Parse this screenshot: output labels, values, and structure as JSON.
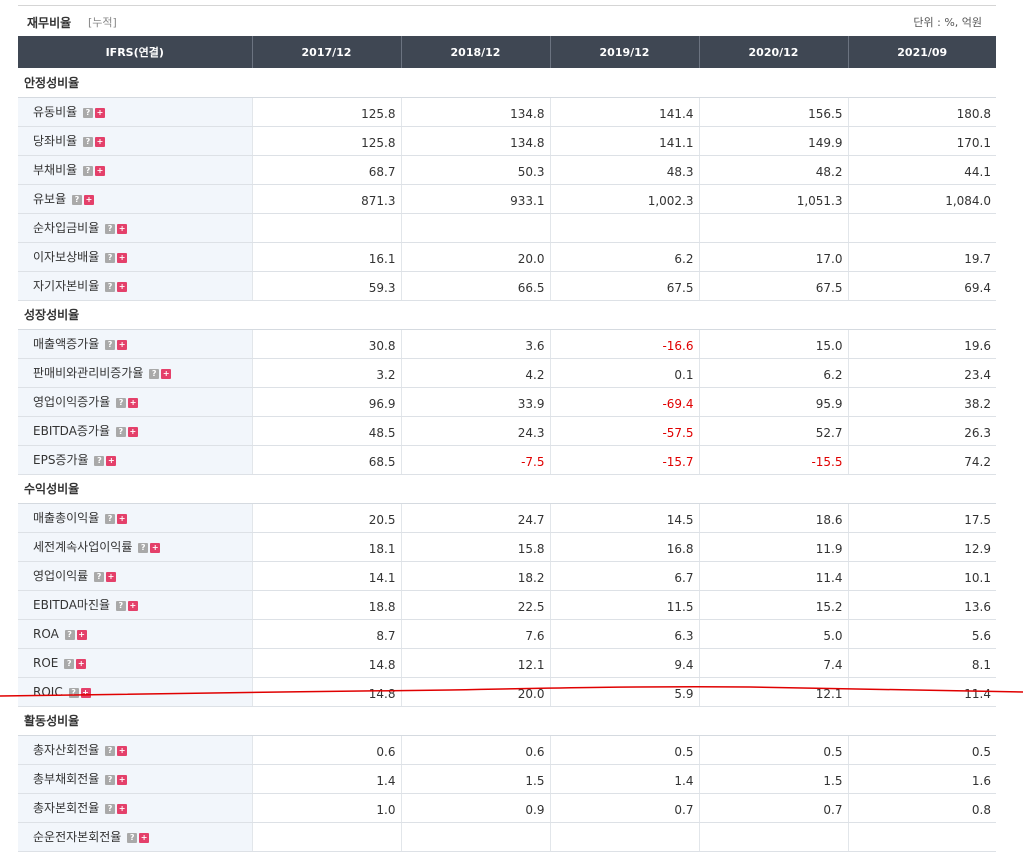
{
  "title": "재무비율",
  "subtitle": "[누적]",
  "unit": "단위 : %, 억원",
  "columns": [
    "IFRS(연결)",
    "2017/12",
    "2018/12",
    "2019/12",
    "2020/12",
    "2021/09"
  ],
  "rows": [
    {
      "section": "안정성비율"
    },
    {
      "label": "유동비율",
      "values": [
        "125.8",
        "134.8",
        "141.4",
        "156.5",
        "180.8"
      ]
    },
    {
      "label": "당좌비율",
      "values": [
        "125.8",
        "134.8",
        "141.1",
        "149.9",
        "170.1"
      ]
    },
    {
      "label": "부채비율",
      "values": [
        "68.7",
        "50.3",
        "48.3",
        "48.2",
        "44.1"
      ]
    },
    {
      "label": "유보율",
      "values": [
        "871.3",
        "933.1",
        "1,002.3",
        "1,051.3",
        "1,084.0"
      ]
    },
    {
      "label": "순차입금비율",
      "values": [
        "",
        "",
        "",
        "",
        ""
      ]
    },
    {
      "label": "이자보상배율",
      "values": [
        "16.1",
        "20.0",
        "6.2",
        "17.0",
        "19.7"
      ]
    },
    {
      "label": "자기자본비율",
      "values": [
        "59.3",
        "66.5",
        "67.5",
        "67.5",
        "69.4"
      ]
    },
    {
      "section": "성장성비율"
    },
    {
      "label": "매출액증가율",
      "values": [
        "30.8",
        "3.6",
        "-16.6",
        "15.0",
        "19.6"
      ]
    },
    {
      "label": "판매비와관리비증가율",
      "values": [
        "3.2",
        "4.2",
        "0.1",
        "6.2",
        "23.4"
      ]
    },
    {
      "label": "영업이익증가율",
      "values": [
        "96.9",
        "33.9",
        "-69.4",
        "95.9",
        "38.2"
      ]
    },
    {
      "label": "EBITDA증가율",
      "values": [
        "48.5",
        "24.3",
        "-57.5",
        "52.7",
        "26.3"
      ]
    },
    {
      "label": "EPS증가율",
      "values": [
        "68.5",
        "-7.5",
        "-15.7",
        "-15.5",
        "74.2"
      ]
    },
    {
      "section": "수익성비율"
    },
    {
      "label": "매출총이익율",
      "values": [
        "20.5",
        "24.7",
        "14.5",
        "18.6",
        "17.5"
      ]
    },
    {
      "label": "세전계속사업이익률",
      "values": [
        "18.1",
        "15.8",
        "16.8",
        "11.9",
        "12.9"
      ]
    },
    {
      "label": "영업이익률",
      "values": [
        "14.1",
        "18.2",
        "6.7",
        "11.4",
        "10.1"
      ]
    },
    {
      "label": "EBITDA마진율",
      "values": [
        "18.8",
        "22.5",
        "11.5",
        "15.2",
        "13.6"
      ]
    },
    {
      "label": "ROA",
      "values": [
        "8.7",
        "7.6",
        "6.3",
        "5.0",
        "5.6"
      ]
    },
    {
      "label": "ROE",
      "values": [
        "14.8",
        "12.1",
        "9.4",
        "7.4",
        "8.1"
      ]
    },
    {
      "label": "ROIC",
      "values": [
        "14.8",
        "20.0",
        "5.9",
        "12.1",
        "11.4"
      ]
    },
    {
      "section": "활동성비율"
    },
    {
      "label": "총자산회전율",
      "values": [
        "0.6",
        "0.6",
        "0.5",
        "0.5",
        "0.5"
      ]
    },
    {
      "label": "총부채회전율",
      "values": [
        "1.4",
        "1.5",
        "1.4",
        "1.5",
        "1.6"
      ]
    },
    {
      "label": "총자본회전율",
      "values": [
        "1.0",
        "0.9",
        "0.7",
        "0.7",
        "0.8"
      ]
    },
    {
      "label": "순운전자본회전율",
      "values": [
        "",
        "",
        "",
        "",
        ""
      ]
    }
  ],
  "icons": {
    "help": "?",
    "expand": "+"
  },
  "colors": {
    "header_bg": "#3f4753",
    "label_bg": "#f2f6fb",
    "negative": "#e00000",
    "annotation": "#e00000"
  }
}
